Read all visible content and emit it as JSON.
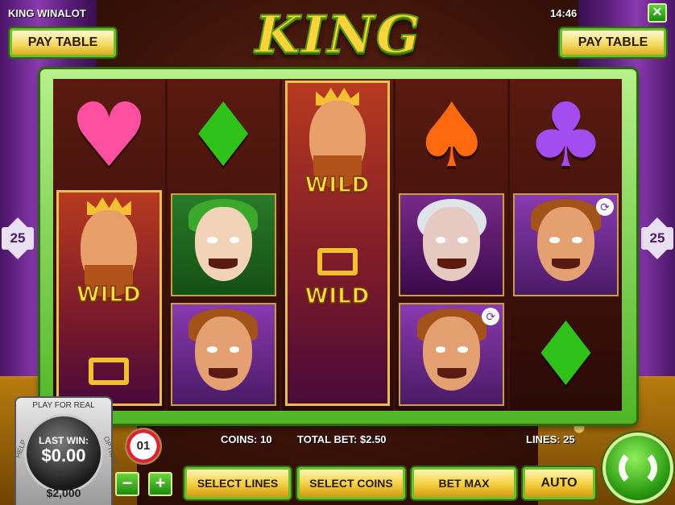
{
  "header": {
    "game_name": "KING WINALOT",
    "clock": "14:46",
    "close_label": "✕",
    "logo": "KING WINALOT",
    "paytable_label": "PAY TABLE"
  },
  "reels": {
    "wild_label": "WILD",
    "columns": [
      [
        "heart",
        "king-wild",
        "king-wild"
      ],
      [
        "diamond",
        "jester",
        "knight"
      ],
      [
        "king-wild",
        "king-wild",
        "king-wild"
      ],
      [
        "spade",
        "queen",
        "knight"
      ],
      [
        "club",
        "knight",
        "diamond"
      ]
    ]
  },
  "lines_indicator": {
    "value": "25"
  },
  "bottom": {
    "play_for_real": "PLAY FOR REAL",
    "last_win_label": "LAST WIN:",
    "last_win_value": "$0.00",
    "balance": "$2,000",
    "help_label": "HELP",
    "options_label": "OPTIONS",
    "coin_value": "01",
    "coins_text": "COINS: 10",
    "total_bet_text": "TOTAL BET: $2.50",
    "lines_text": "LINES: 25",
    "minus_label": "−",
    "plus_label": "+",
    "select_lines_label": "SELECT LINES",
    "select_coins_label": "SELECT COINS",
    "bet_max_label": "BET MAX",
    "auto_label": "AUTO"
  },
  "colors": {
    "accent_green": "#4fb526",
    "gold": "#f2ce40",
    "curtain_purple": "#8a3ab0"
  },
  "icons": {
    "heart": "♥",
    "diamond": "♦",
    "spade": "♠",
    "club": "♣"
  }
}
